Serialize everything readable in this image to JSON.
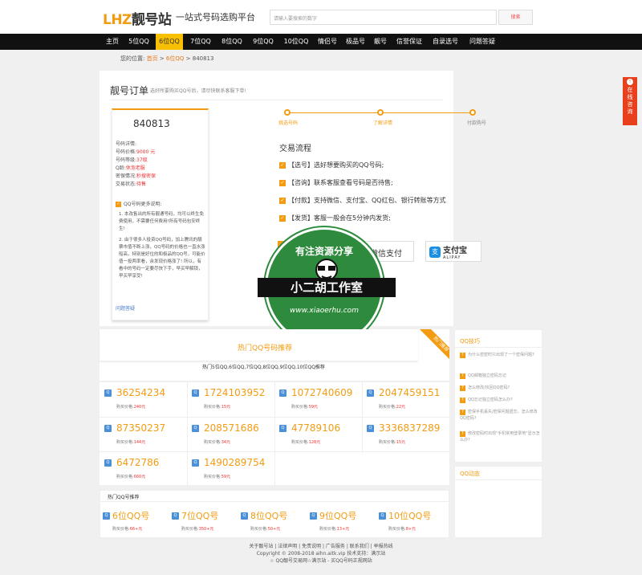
{
  "header": {
    "logo_en": "LHZ",
    "logo_cn": "靓号站",
    "slogan": "一站式号码选购平台",
    "search_placeholder": "请输入要搜索的数字",
    "search_button": "搜索"
  },
  "nav": [
    "主页",
    "5位QQ",
    "6位QQ",
    "7位QQ",
    "8位QQ",
    "9位QQ",
    "10位QQ",
    "情侣号",
    "极品号",
    "靓号",
    "信誉保证",
    "自录选号",
    "问题答疑"
  ],
  "breadcrumb": {
    "prefix": "您的位置:",
    "home": "首页",
    "sep1": " > ",
    "cat": "6位QQ",
    "sep2": " > ",
    "current": "840813"
  },
  "order": {
    "title": "靓号订单",
    "subtitle": "选好所要购买QQ号后，请尽快联系客服下单!",
    "number": "840813",
    "details_label": "号码详情:",
    "price_label": "号码价格:",
    "price": "9000 元",
    "level_label": "号码等级:",
    "level": "37级",
    "qage_label": "Q龄:",
    "qage": "休泡老服",
    "security_label": "密保情况:",
    "security": "秒搜密保",
    "status_label": "交易状态:",
    "status": "待售",
    "note_title": "QQ号码更多说明:",
    "note_1": "1. 本改售出的所有靓通号码，均可以终生免费使用，不需要任何费用!所有号码包安终生!",
    "note_2": "2. 由于很多人投资QQ号码，加上腾讯的靓票市值不断上涨，QQ号码的价格也一直水涨船高，特别是好位的和极品的QQ号，可能价值一投两率看，余发现价格涨了! 所以，有看中的号码一定要尽快下手，早买早解锁，早买早享受!",
    "help_link": "问题答疑"
  },
  "steps": [
    "挑选号码",
    "了解详情",
    "付款购号"
  ],
  "flow": {
    "title": "交易流程",
    "items": [
      "【选号】选好想要购买的QQ号码;",
      "【咨询】联系客服查看号码是否待售;",
      "【付款】支持微信、支付宝、QQ红包、银行转账等方式",
      "【发货】客服一般会在5分钟内发货;"
    ]
  },
  "pay": {
    "wechat": "微信支付",
    "alipay_cn": "支付宝",
    "alipay_en": "ALIPAY"
  },
  "watermark": {
    "top": "有注资源分享",
    "band": "小二胡工作室",
    "bottom": "www.xiaoerhu.com"
  },
  "hot": {
    "title": "热门QQ号码推荐",
    "subtitle": "热门5位QQ,6位QQ,7位QQ,8位QQ,9位QQ,10位QQ推荐",
    "corner": "热门推荐",
    "price_label": "购买价格:",
    "items": [
      {
        "num": "36254234",
        "price": "240元"
      },
      {
        "num": "1724103952",
        "price": "15元"
      },
      {
        "num": "1072740609",
        "price": "59元"
      },
      {
        "num": "2047459151",
        "price": "22元"
      },
      {
        "num": "87350237",
        "price": "144元"
      },
      {
        "num": "208571686",
        "price": "34元"
      },
      {
        "num": "47789106",
        "price": "128元"
      },
      {
        "num": "3336837289",
        "price": "15元"
      },
      {
        "num": "6472786",
        "price": "660元"
      },
      {
        "num": "1490289754",
        "price": "59元"
      }
    ]
  },
  "rec": {
    "title": "热门QQ号推荐",
    "price_label": "购买价格:",
    "items": [
      {
        "label": "6位QQ号",
        "price": "66+元"
      },
      {
        "label": "7位QQ号",
        "price": "350+元"
      },
      {
        "label": "8位QQ号",
        "price": "50+元"
      },
      {
        "label": "9位QQ号",
        "price": "13+元"
      },
      {
        "label": "10位QQ号",
        "price": "8+元"
      }
    ]
  },
  "side": {
    "tips_title": "QQ技巧",
    "tips": [
      "为什么密密时只出现了一个密保问题?",
      "QQ邮箱独立密码忘记",
      "怎么修改/找回QQ密码?",
      "QQ忘记独立密码怎么办?",
      "密保手机丢失/密保问题遗忘，怎么修改QQ密码?",
      "修改密码时出现\"手机常用登录地\"显示怎么办?"
    ],
    "news_title": "QQ动态"
  },
  "footer": {
    "links": "关于靓号站 | 法律声明 | 免责说明 | 广告服务 | 联系我们 | 举报热线",
    "copyright": "Copyright © 2008-2018 aihn.aitk.vip 技术支持：满示站",
    "line3": "☆ QQ靓号交易网☆满示站 - 买QQ号码正规网站"
  },
  "online": {
    "text": "在线咨询"
  },
  "colors": {
    "accent": "#f39c12",
    "nav_bg": "#111111",
    "nav_active": "#f8c000",
    "online": "#e8401c",
    "price_red": "#e33333"
  }
}
